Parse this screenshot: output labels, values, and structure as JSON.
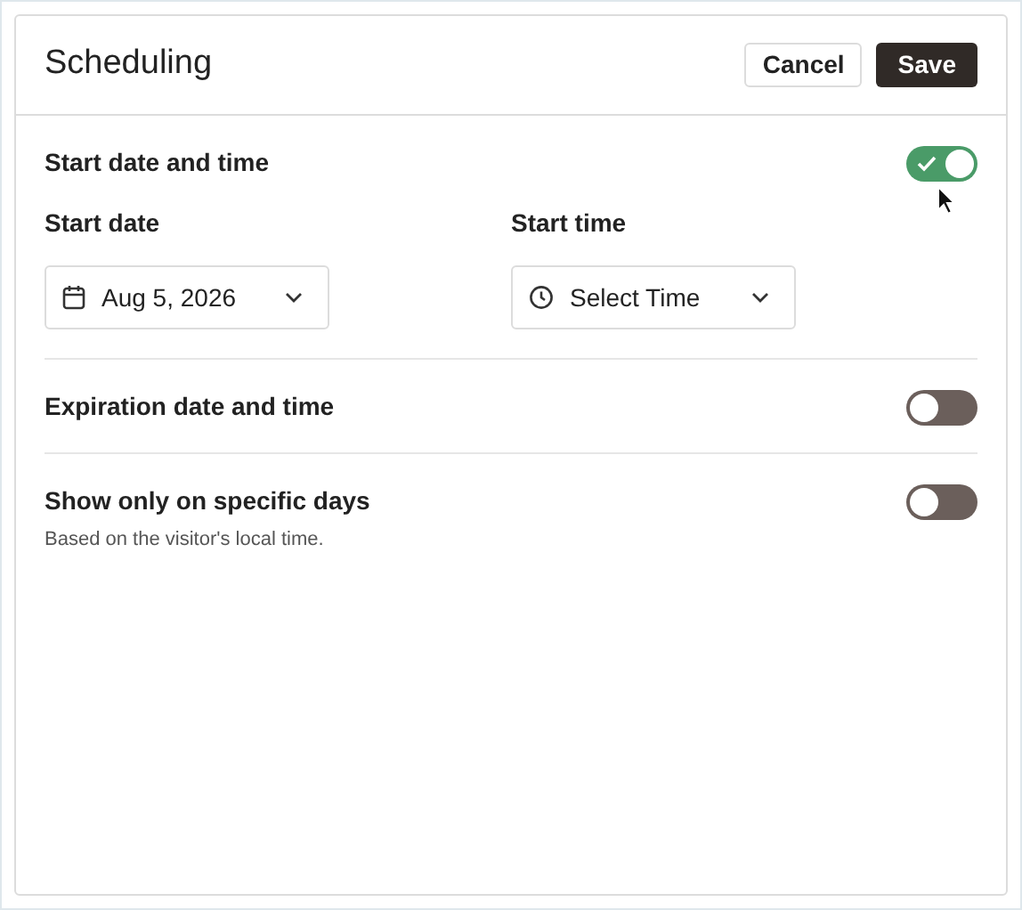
{
  "title": "Scheduling",
  "buttons": [
    {
      "kind": "secondary",
      "label": "Cancel"
    },
    {
      "kind": "primary",
      "label": "Save"
    }
  ],
  "sections": [
    {
      "label": "Start date and time",
      "on": true,
      "fields": [
        {
          "label": "Start date",
          "kind": "date",
          "value": "Aug 5, 2026"
        },
        {
          "label": "Start time",
          "kind": "time",
          "value": "Select Time"
        }
      ]
    },
    {
      "label": "Expiration date and time",
      "on": false
    },
    {
      "label": "Show only on specific days",
      "on": false,
      "note": "Based on the visitor's local time."
    }
  ]
}
